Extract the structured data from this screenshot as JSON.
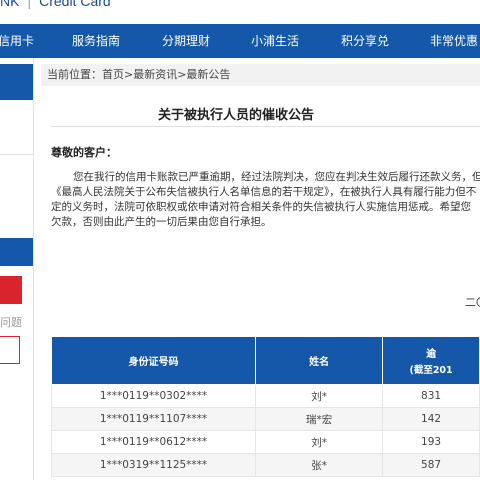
{
  "header": {
    "brand_left": "NK",
    "brand_right": "Credit Card"
  },
  "nav": {
    "items": [
      {
        "label": "信用卡"
      },
      {
        "label": "服务指南"
      },
      {
        "label": "分期理财"
      },
      {
        "label": "小浦生活"
      },
      {
        "label": "积分享兑"
      },
      {
        "label": "非常优惠"
      }
    ]
  },
  "sidebar": {
    "text": "问题"
  },
  "main": {
    "breadcrumb": "当前位置：首页>最新资讯>最新公告",
    "title": "关于被执行人员的催收公告",
    "greeting": "尊敬的客户：",
    "paragraph_lines": [
      "您在我行的信用卡账款已严重逾期，经过法院判决，您应在判决生效后履行还款义务，但",
      "《最高人民法院关于公布失信被执行人名单信息的若干规定》，在被执行人具有履行能力但不",
      "定的义务时，法院可依职权或依申请对符合相关条件的失信被执行人实施信用惩戒。希望您",
      "欠款，否则由此产生的一切后果由您自行承担。"
    ],
    "date": "二〇"
  },
  "table": {
    "headers": [
      "身份证号码",
      "姓名",
      "逾",
      "(截至201"
    ],
    "rows": [
      [
        "1***0119**0302****",
        "刘*",
        "831"
      ],
      [
        "1***0119**1107****",
        "瑞*宏",
        "142"
      ],
      [
        "1***0119**0612****",
        "刘*",
        "193"
      ],
      [
        "1***0319**1125****",
        "张*",
        "587"
      ]
    ]
  }
}
